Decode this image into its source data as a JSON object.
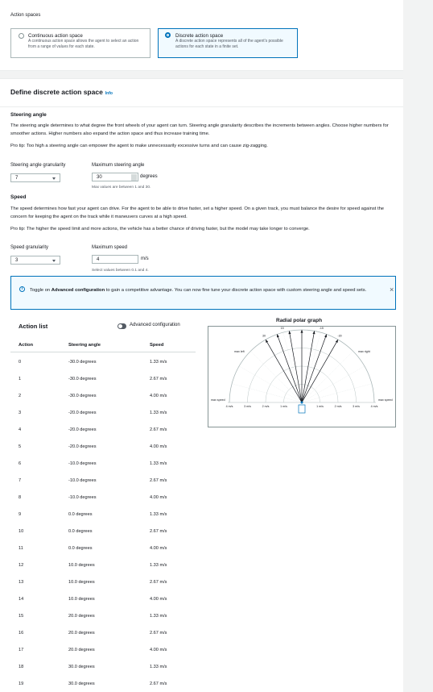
{
  "section_label": "Action spaces",
  "tiles": [
    {
      "title": "Continuous action space",
      "desc": "A continuous action space allows the agent to select an action from a range of values for each state.",
      "selected": false
    },
    {
      "title": "Discrete action space",
      "desc": "A discrete action space represents all of the agent's possible actions for each state in a finite set.",
      "selected": true
    }
  ],
  "define": {
    "title": "Define discrete action space",
    "info": "Info"
  },
  "steering": {
    "title": "Steering angle",
    "desc": "The steering angle determines to what degree the front wheels of your agent can turn. Steering angle granularity describes the increments between angles. Choose higher numbers for smoother actions. Higher numbers also expand the action space and thus increase training time.",
    "tip": "Pro tip: Too high a steering angle can empower the agent to make unnecessarily excessive turns and can cause zig-zagging.",
    "granularity_label": "Steering angle granularity",
    "granularity_value": "7",
    "max_label": "Maximum steering angle",
    "max_value": "30",
    "max_unit": "degrees",
    "max_hint": "Max values are between 1 and 30."
  },
  "speed": {
    "title": "Speed",
    "desc": "The speed determines how fast your agent can drive. For the agent to be able to drive faster, set a higher speed. On a given track, you must balance the desire for speed against the concern for keeping the agent on the track while it maneuvers curves at a high speed.",
    "tip": "Pro tip: The higher the speed limit and more actions, the vehicle has a better chance of driving faster, but the model may take longer to converge.",
    "granularity_label": "Speed granularity",
    "granularity_value": "3",
    "max_label": "Maximum speed",
    "max_value": "4",
    "max_unit": "m/s",
    "max_hint": "Select values between 0.1 and 4."
  },
  "banner": {
    "text_prefix": "Toggle on ",
    "text_bold": "Advanced configuration",
    "text_suffix": " to gain a competitive advantage. You can now fine tune your discrete action space with custom steering angle and speed sets.",
    "icon": "info-icon",
    "close": "close-icon"
  },
  "action_list": {
    "title": "Action list",
    "toggle_label": "Advanced configuration",
    "columns": [
      "Action",
      "Steering angle",
      "Speed"
    ],
    "rows": [
      [
        "0",
        "-30.0 degrees",
        "1.33 m/s"
      ],
      [
        "1",
        "-30.0 degrees",
        "2.67 m/s"
      ],
      [
        "2",
        "-30.0 degrees",
        "4.00 m/s"
      ],
      [
        "3",
        "-20.0 degrees",
        "1.33 m/s"
      ],
      [
        "4",
        "-20.0 degrees",
        "2.67 m/s"
      ],
      [
        "5",
        "-20.0 degrees",
        "4.00 m/s"
      ],
      [
        "6",
        "-10.0 degrees",
        "1.33 m/s"
      ],
      [
        "7",
        "-10.0 degrees",
        "2.67 m/s"
      ],
      [
        "8",
        "-10.0 degrees",
        "4.00 m/s"
      ],
      [
        "9",
        "0.0 degrees",
        "1.33 m/s"
      ],
      [
        "10",
        "0.0 degrees",
        "2.67 m/s"
      ],
      [
        "11",
        "0.0 degrees",
        "4.00 m/s"
      ],
      [
        "12",
        "10.0 degrees",
        "1.33 m/s"
      ],
      [
        "13",
        "10.0 degrees",
        "2.67 m/s"
      ],
      [
        "14",
        "10.0 degrees",
        "4.00 m/s"
      ],
      [
        "15",
        "20.0 degrees",
        "1.33 m/s"
      ],
      [
        "16",
        "20.0 degrees",
        "2.67 m/s"
      ],
      [
        "17",
        "20.0 degrees",
        "4.00 m/s"
      ],
      [
        "18",
        "30.0 degrees",
        "1.33 m/s"
      ],
      [
        "19",
        "30.0 degrees",
        "2.67 m/s"
      ]
    ]
  },
  "chart": {
    "title": "Radial polar graph",
    "angle_labels": [
      "0",
      "15",
      "-15",
      "30",
      "-30"
    ],
    "corner_labels": {
      "max_left": "max left",
      "max_right": "max right",
      "max_speed": "max speed"
    },
    "speed_tick_labels": [
      "4 m/s",
      "3 m/s",
      "2 m/s",
      "1 m/s"
    ],
    "colors": {
      "ray": "#16191f",
      "grid": "#aab7b8",
      "center": "#0073bb"
    }
  },
  "chart_data": {
    "type": "scatter",
    "title": "Radial polar graph",
    "series": [
      {
        "steering_deg": [
          -30,
          -20,
          -10,
          0,
          10,
          20,
          30
        ],
        "max_speed_mps": 4.0
      }
    ],
    "speed_range_mps": [
      0,
      4
    ]
  }
}
